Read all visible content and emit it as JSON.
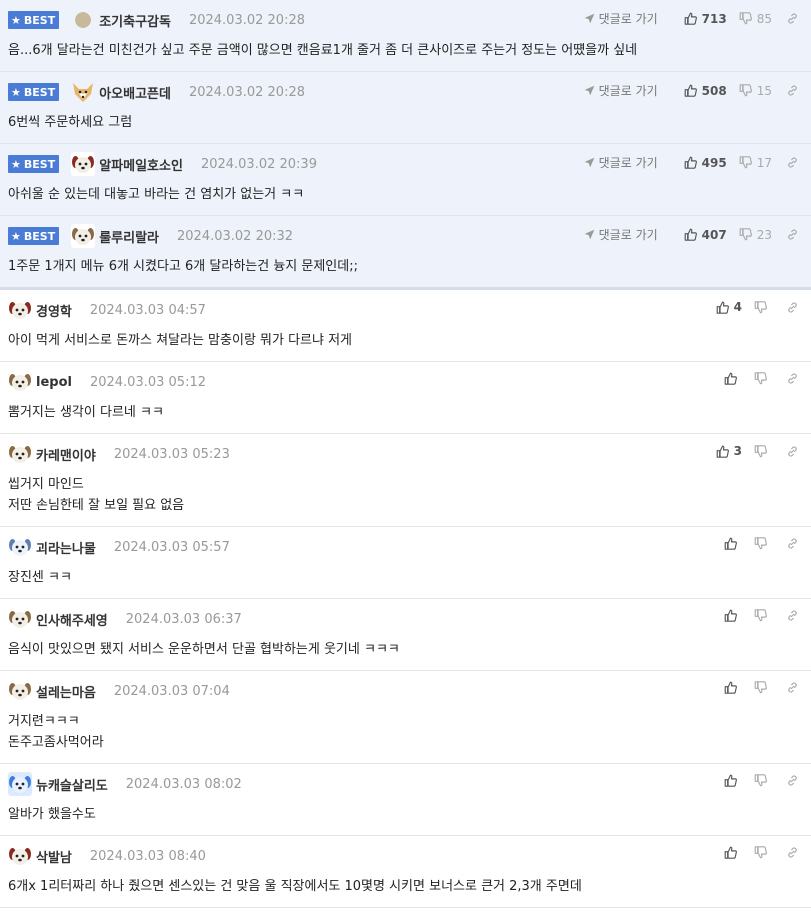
{
  "best_label": "BEST",
  "goto_label": "댓글로 가기",
  "comments": [
    {
      "best": true,
      "nick": "조기축구감독",
      "date": "2024.03.02 20:28",
      "up": "713",
      "down": "85",
      "avatar": "dot",
      "lines": [
        "음...6개 달라는건 미친건가 싶고 주문 금액이 많으면 캔음료1개 줄거 좀 더 큰사이즈로 주는거 정도는 어떘을까 싶네"
      ]
    },
    {
      "best": true,
      "nick": "아오배고픈데",
      "date": "2024.03.02 20:28",
      "up": "508",
      "down": "15",
      "avatar": "fox",
      "lines": [
        "6번씩 주문하세요 그럼"
      ]
    },
    {
      "best": true,
      "nick": "알파메일호소인",
      "date": "2024.03.02 20:39",
      "up": "495",
      "down": "17",
      "avatar": "dog-red",
      "lines": [
        "아쉬울 순 있는데 대놓고 바라는 건 염치가 없는거 ㅋㅋ"
      ]
    },
    {
      "best": true,
      "nick": "룰루리랄라",
      "date": "2024.03.02 20:32",
      "up": "407",
      "down": "23",
      "avatar": "dog",
      "lines": [
        "1주문 1개지 메뉴 6개 시켰다고 6개 달라하는건 늉지 문제인데;;"
      ]
    },
    {
      "best": false,
      "nick": "경영학",
      "date": "2024.03.03 04:57",
      "up": "4",
      "down": "",
      "avatar": "dog-red",
      "lines": [
        "아이 먹게 서비스로 돈까스 쳐달라는 맘충이랑 뭐가 다르냐 저게"
      ]
    },
    {
      "best": false,
      "nick": "lepol",
      "date": "2024.03.03 05:12",
      "up": "",
      "down": "",
      "avatar": "dog",
      "lines": [
        "뽐거지는 생각이 다르네 ㅋㅋ"
      ]
    },
    {
      "best": false,
      "nick": "카레맨이야",
      "date": "2024.03.03 05:23",
      "up": "3",
      "down": "",
      "avatar": "dog",
      "lines": [
        "씹거지 마인드",
        "저딴 손님한테 잘 보일 필요 없음"
      ]
    },
    {
      "best": false,
      "nick": "괴라는나물",
      "date": "2024.03.03 05:57",
      "up": "",
      "down": "",
      "avatar": "dog-blue",
      "lines": [
        "장진센 ㅋㅋ"
      ]
    },
    {
      "best": false,
      "nick": "인사해주세영",
      "date": "2024.03.03 06:37",
      "up": "",
      "down": "",
      "avatar": "dog",
      "lines": [
        "음식이 맛있으면 됐지 서비스 운운하면서 단골 협박하는게 웃기네 ㅋㅋㅋ"
      ]
    },
    {
      "best": false,
      "nick": "설레는마음",
      "date": "2024.03.03 07:04",
      "up": "",
      "down": "",
      "avatar": "dog",
      "lines": [
        "거지련ㅋㅋㅋ",
        "돈주고좀사먹어라"
      ]
    },
    {
      "best": false,
      "nick": "뉴캐슬살리도",
      "date": "2024.03.03 08:02",
      "up": "",
      "down": "",
      "avatar": "dog-blue2",
      "lines": [
        "알바가 했을수도"
      ]
    },
    {
      "best": false,
      "nick": "삭발남",
      "date": "2024.03.03 08:40",
      "up": "",
      "down": "",
      "avatar": "dog-red",
      "lines": [
        "6개x 1리터짜리 하나 줬으면 센스있는 건 맞음 울 직장에서도 10몇명 시키면 보너스로 큰거 2,3개 주면데"
      ]
    }
  ],
  "colors": {
    "best_badge": "#4a7bd6",
    "best_bg": "#eef2fa"
  }
}
